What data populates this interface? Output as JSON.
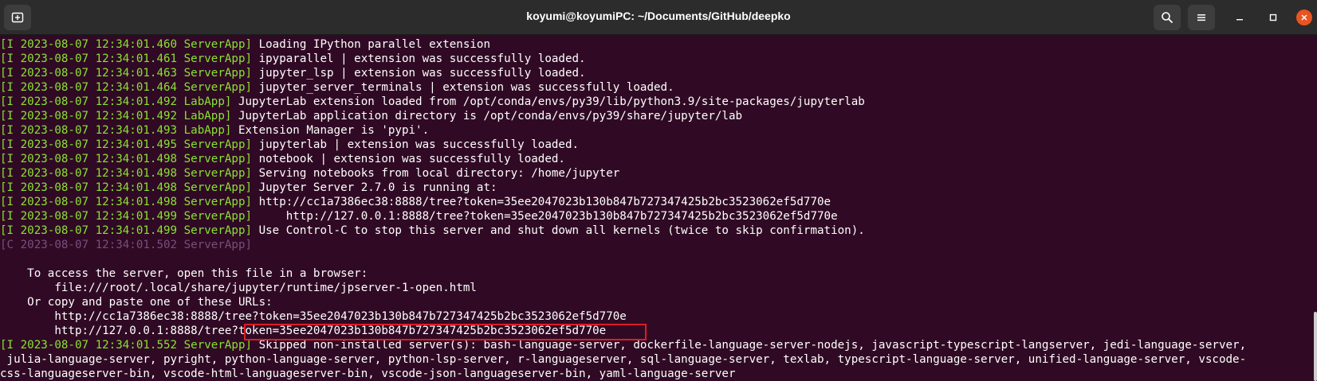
{
  "window": {
    "title": "koyumi@koyumiPC: ~/Documents/GitHub/deepko",
    "icons": [
      "new-tab-icon",
      "search-icon",
      "menu-icon",
      "minimize-icon",
      "maximize-icon",
      "close-icon"
    ]
  },
  "colors": {
    "terminal_bg": "#300a24",
    "log_prefix": "#8ae234",
    "log_prefix_ctrl": "#75507b",
    "text": "#ffffff",
    "highlight_border": "#e01b24",
    "titlebar_bg": "#2c2c2c"
  },
  "terminal": {
    "lines": [
      {
        "prefix": "[I 2023-08-07 12:34:01.460 ServerApp]",
        "text": " Loading IPython parallel extension",
        "style": "green"
      },
      {
        "prefix": "[I 2023-08-07 12:34:01.461 ServerApp]",
        "text": " ipyparallel | extension was successfully loaded.",
        "style": "green"
      },
      {
        "prefix": "[I 2023-08-07 12:34:01.463 ServerApp]",
        "text": " jupyter_lsp | extension was successfully loaded.",
        "style": "green"
      },
      {
        "prefix": "[I 2023-08-07 12:34:01.464 ServerApp]",
        "text": " jupyter_server_terminals | extension was successfully loaded.",
        "style": "green"
      },
      {
        "prefix": "[I 2023-08-07 12:34:01.492 LabApp]",
        "text": " JupyterLab extension loaded from /opt/conda/envs/py39/lib/python3.9/site-packages/jupyterlab",
        "style": "green"
      },
      {
        "prefix": "[I 2023-08-07 12:34:01.492 LabApp]",
        "text": " JupyterLab application directory is /opt/conda/envs/py39/share/jupyter/lab",
        "style": "green"
      },
      {
        "prefix": "[I 2023-08-07 12:34:01.493 LabApp]",
        "text": " Extension Manager is 'pypi'.",
        "style": "green"
      },
      {
        "prefix": "[I 2023-08-07 12:34:01.495 ServerApp]",
        "text": " jupyterlab | extension was successfully loaded.",
        "style": "green"
      },
      {
        "prefix": "[I 2023-08-07 12:34:01.498 ServerApp]",
        "text": " notebook | extension was successfully loaded.",
        "style": "green"
      },
      {
        "prefix": "[I 2023-08-07 12:34:01.498 ServerApp]",
        "text": " Serving notebooks from local directory: /home/jupyter",
        "style": "green"
      },
      {
        "prefix": "[I 2023-08-07 12:34:01.498 ServerApp]",
        "text": " Jupyter Server 2.7.0 is running at:",
        "style": "green"
      },
      {
        "prefix": "[I 2023-08-07 12:34:01.498 ServerApp]",
        "text": " http://cc1a7386ec38:8888/tree?token=35ee2047023b130b847b727347425b2bc3523062ef5d770e",
        "style": "green"
      },
      {
        "prefix": "[I 2023-08-07 12:34:01.499 ServerApp]",
        "text": "     http://127.0.0.1:8888/tree?token=35ee2047023b130b847b727347425b2bc3523062ef5d770e",
        "style": "green"
      },
      {
        "prefix": "[I 2023-08-07 12:34:01.499 ServerApp]",
        "text": " Use Control-C to stop this server and shut down all kernels (twice to skip confirmation).",
        "style": "green"
      },
      {
        "prefix": "[C 2023-08-07 12:34:01.502 ServerApp]",
        "text": "",
        "style": "gray"
      },
      {
        "prefix": "",
        "text": "",
        "style": "plain"
      },
      {
        "prefix": "",
        "text": "    To access the server, open this file in a browser:",
        "style": "plain"
      },
      {
        "prefix": "",
        "text": "        file:///root/.local/share/jupyter/runtime/jpserver-1-open.html",
        "style": "plain"
      },
      {
        "prefix": "",
        "text": "    Or copy and paste one of these URLs:",
        "style": "plain"
      },
      {
        "prefix": "",
        "text": "        http://cc1a7386ec38:8888/tree?token=35ee2047023b130b847b727347425b2bc3523062ef5d770e",
        "style": "plain"
      },
      {
        "prefix": "",
        "text": "        http://127.0.0.1:8888/tree?token=35ee2047023b130b847b727347425b2bc3523062ef5d770e",
        "style": "plain"
      },
      {
        "prefix": "[I 2023-08-07 12:34:01.552 ServerApp]",
        "text": " Skipped non-installed server(s): bash-language-server, dockerfile-language-server-nodejs, javascript-typescript-langserver, jedi-language-server,",
        "style": "green"
      },
      {
        "prefix": "",
        "text": " julia-language-server, pyright, python-language-server, python-lsp-server, r-languageserver, sql-language-server, texlab, typescript-language-server, unified-language-server, vscode-",
        "style": "plain"
      },
      {
        "prefix": "",
        "text": "css-languageserver-bin, vscode-html-languageserver-bin, vscode-json-languageserver-bin, yaml-language-server",
        "style": "plain"
      }
    ]
  }
}
